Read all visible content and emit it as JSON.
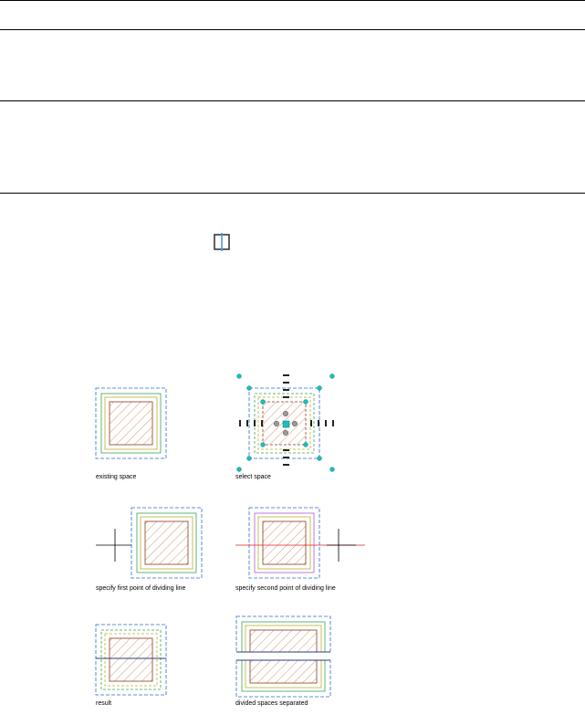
{
  "header": {
    "title": ""
  },
  "icons": {
    "divide_space_tool": "divide-space-icon"
  },
  "colors": {
    "outer_boundary": "#2b6fc9",
    "ceiling": "#3aa35a",
    "floor": "#b9b02a",
    "hatch": "#b5522e",
    "inner": "#8a7a2a",
    "grip": "#19c0c0",
    "dividing_line": "#e02020",
    "highlight": "#b05ad0"
  },
  "figures": [
    {
      "id": "existing",
      "caption": "existing space"
    },
    {
      "id": "select",
      "caption": "select space"
    },
    {
      "id": "first-point",
      "caption": "specify first point of dividing line"
    },
    {
      "id": "second-point",
      "caption": "specify second point of dividing line"
    },
    {
      "id": "result",
      "caption": "result"
    },
    {
      "id": "separated",
      "caption": "divided spaces separated"
    }
  ]
}
